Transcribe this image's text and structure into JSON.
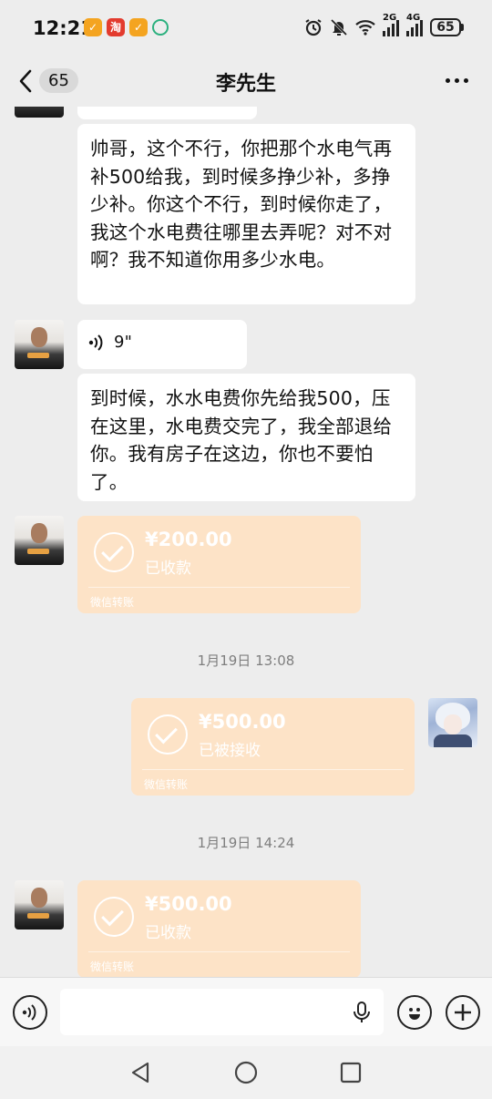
{
  "status_bar": {
    "time": "12:21",
    "app_icons": [
      "app-icon-orange",
      "taobao-icon",
      "app-icon-orange",
      "mobile-network-icon"
    ],
    "signal_labels": [
      "2G",
      "4G"
    ],
    "battery": "65"
  },
  "nav": {
    "unread_count": "65",
    "title": "李先生"
  },
  "messages": {
    "text1": "帅哥，这个不行，你把那个水电气再补500给我，到时候多挣少补，多挣少补。你这个不行，到时候你走了，我这个水电费往哪里去弄呢？对不对啊？我不知道你用多少水电。",
    "voice_duration": "9\"",
    "text2": "到时候，水水电费你先给我500，压在这里，水电费交完了，我全部退给你。我有房子在这边，你也不要怕了。",
    "transfer1": {
      "amount": "¥200.00",
      "status": "已收款",
      "source": "微信转账"
    },
    "timestamp1": "1月19日 13:08",
    "transfer2": {
      "amount": "¥500.00",
      "status": "已被接收",
      "source": "微信转账"
    },
    "timestamp2": "1月19日 14:24",
    "transfer3": {
      "amount": "¥500.00",
      "status": "已收款",
      "source": "微信转账"
    }
  },
  "input": {
    "placeholder": ""
  },
  "colors": {
    "background": "#ededed",
    "transfer_bubble": "#fde3c7",
    "bubble": "#ffffff"
  }
}
